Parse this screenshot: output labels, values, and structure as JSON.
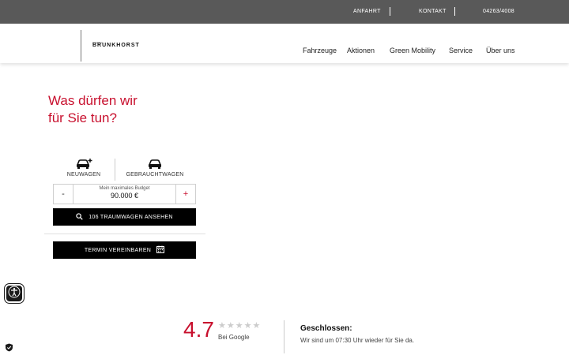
{
  "topbar": {
    "links": [
      "ANFAHRT",
      "KONTAKT",
      "04263/4008"
    ]
  },
  "brand": {
    "small": "Autohaus",
    "name": "BRUNKHORST"
  },
  "nav": {
    "items": [
      "Fahrzeuge",
      "Aktionen",
      "Green Mobility",
      "Service",
      "Über uns"
    ]
  },
  "hero": {
    "line1": "Was dürfen wir",
    "line2": "für Sie tun?"
  },
  "categories": {
    "new_label": "NEUWAGEN",
    "used_label": "GEBRAUCHTWAGEN"
  },
  "budget": {
    "label": "Mein maximales Budget",
    "value": "90.000 €",
    "minus": "-",
    "plus": "+"
  },
  "actions": {
    "search_label": "106 TRAUMWAGEN ANSEHEN",
    "appointment_label": "TERMIN VEREINBAREN"
  },
  "rating": {
    "score": "4.7",
    "stars": "★★★★★",
    "source": "Bei Google"
  },
  "opening": {
    "title": "Geschlossen:",
    "text": "Wir sind um 07:30 Uhr wieder für Sie da."
  },
  "icons": {
    "car_new": "car-plus-icon",
    "car_used": "car-icon",
    "search": "search-icon",
    "calendar": "calendar-icon",
    "accessibility": "accessibility-icon",
    "privacy": "shield-check-icon"
  },
  "colors": {
    "accent": "#c8102e",
    "topbar": "#595959",
    "button": "#000000"
  }
}
